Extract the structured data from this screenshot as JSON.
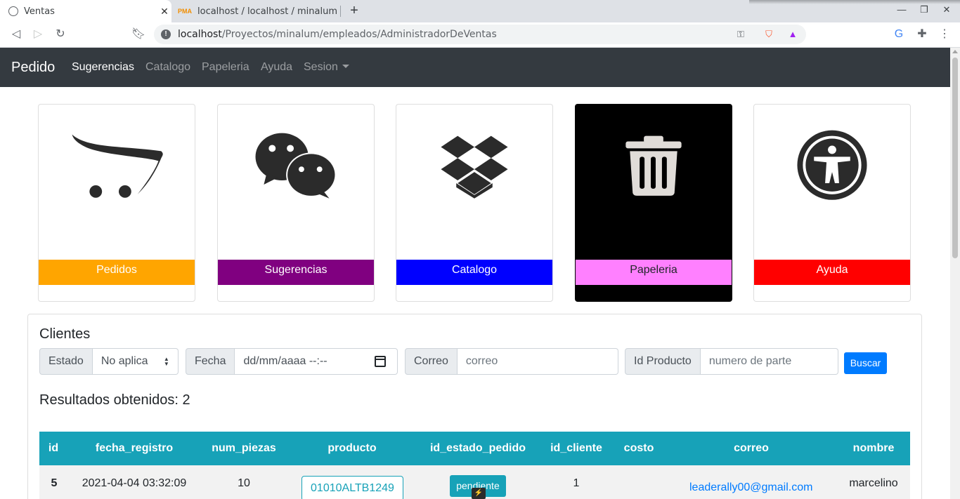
{
  "browser": {
    "tabs": [
      {
        "title": "Ventas",
        "active": true
      },
      {
        "title": "localhost / localhost / minalum",
        "active": false
      }
    ],
    "url_host": "localhost",
    "url_path": "/Proyectos/minalum/empleados/AdministradorDeVentas"
  },
  "navbar": {
    "brand": "Pedido",
    "links": [
      "Sugerencias",
      "Catalogo",
      "Papeleria",
      "Ayuda",
      "Sesion"
    ]
  },
  "cards": [
    {
      "label": "Pedidos",
      "icon": "opencart-icon",
      "color": "#ffa500"
    },
    {
      "label": "Sugerencias",
      "icon": "wechat-icon",
      "color": "#800080"
    },
    {
      "label": "Catalogo",
      "icon": "dropbox-icon",
      "color": "#0000ff"
    },
    {
      "label": "Papeleria",
      "icon": "trash-icon",
      "color": "#ff80ff"
    },
    {
      "label": "Ayuda",
      "icon": "accessibility-icon",
      "color": "#ff0000"
    }
  ],
  "filters": {
    "title": "Clientes",
    "estado_label": "Estado",
    "estado_value": "No aplica",
    "fecha_label": "Fecha",
    "fecha_placeholder": "dd/mm/aaaa --:--",
    "correo_label": "Correo",
    "correo_placeholder": "correo",
    "producto_label": "Id Producto",
    "producto_placeholder": "numero de parte",
    "buscar_label": "Buscar"
  },
  "results_text": "Resultados obtenidos: 2",
  "table": {
    "headers": [
      "id",
      "fecha_registro",
      "num_piezas",
      "producto",
      "id_estado_pedido",
      "id_cliente",
      "costo",
      "correo",
      "nombre"
    ],
    "rows": [
      {
        "id": "5",
        "fecha_registro": "2021-04-04 03:32:09",
        "num_piezas": "10",
        "producto": "01010ALTB1249",
        "estado": "pendiente",
        "id_cliente": "1",
        "costo": "",
        "correo": "leaderally00@gmail.com",
        "nombre": "marcelino"
      }
    ]
  },
  "colors": {
    "navbar_bg": "#343a40",
    "table_header": "#17a2b8",
    "primary": "#007bff"
  }
}
